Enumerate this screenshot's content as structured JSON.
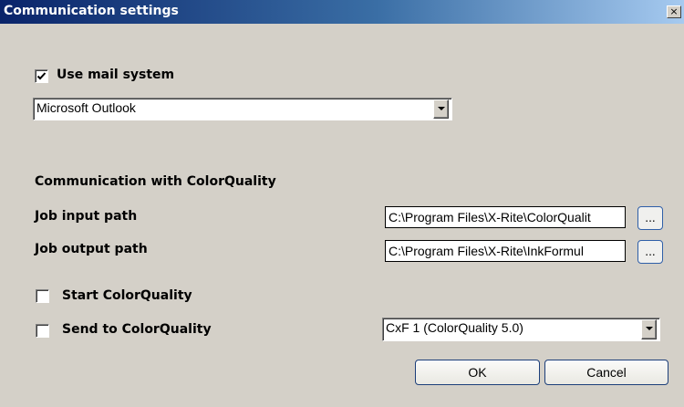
{
  "window": {
    "title": "Communication settings",
    "close_glyph": "×"
  },
  "mail": {
    "use_mail_label": "Use mail system",
    "use_mail_checked": true,
    "mail_client": "Microsoft Outlook"
  },
  "colorquality": {
    "section_heading": "Communication with ColorQuality",
    "job_input_label": "Job input path",
    "job_input_value": "C:\\Program Files\\X-Rite\\ColorQualit",
    "job_output_label": "Job output path",
    "job_output_value": "C:\\Program Files\\X-Rite\\InkFormul",
    "browse_label": "...",
    "start_label": "Start ColorQuality",
    "start_checked": false,
    "send_label": "Send to ColorQuality",
    "send_checked": false,
    "format_selected": "CxF 1 (ColorQuality 5.0)"
  },
  "buttons": {
    "ok": "OK",
    "cancel": "Cancel"
  },
  "icons": {
    "close": "close-icon",
    "dropdown": "chevron-down-icon",
    "check": "checkmark-icon"
  }
}
